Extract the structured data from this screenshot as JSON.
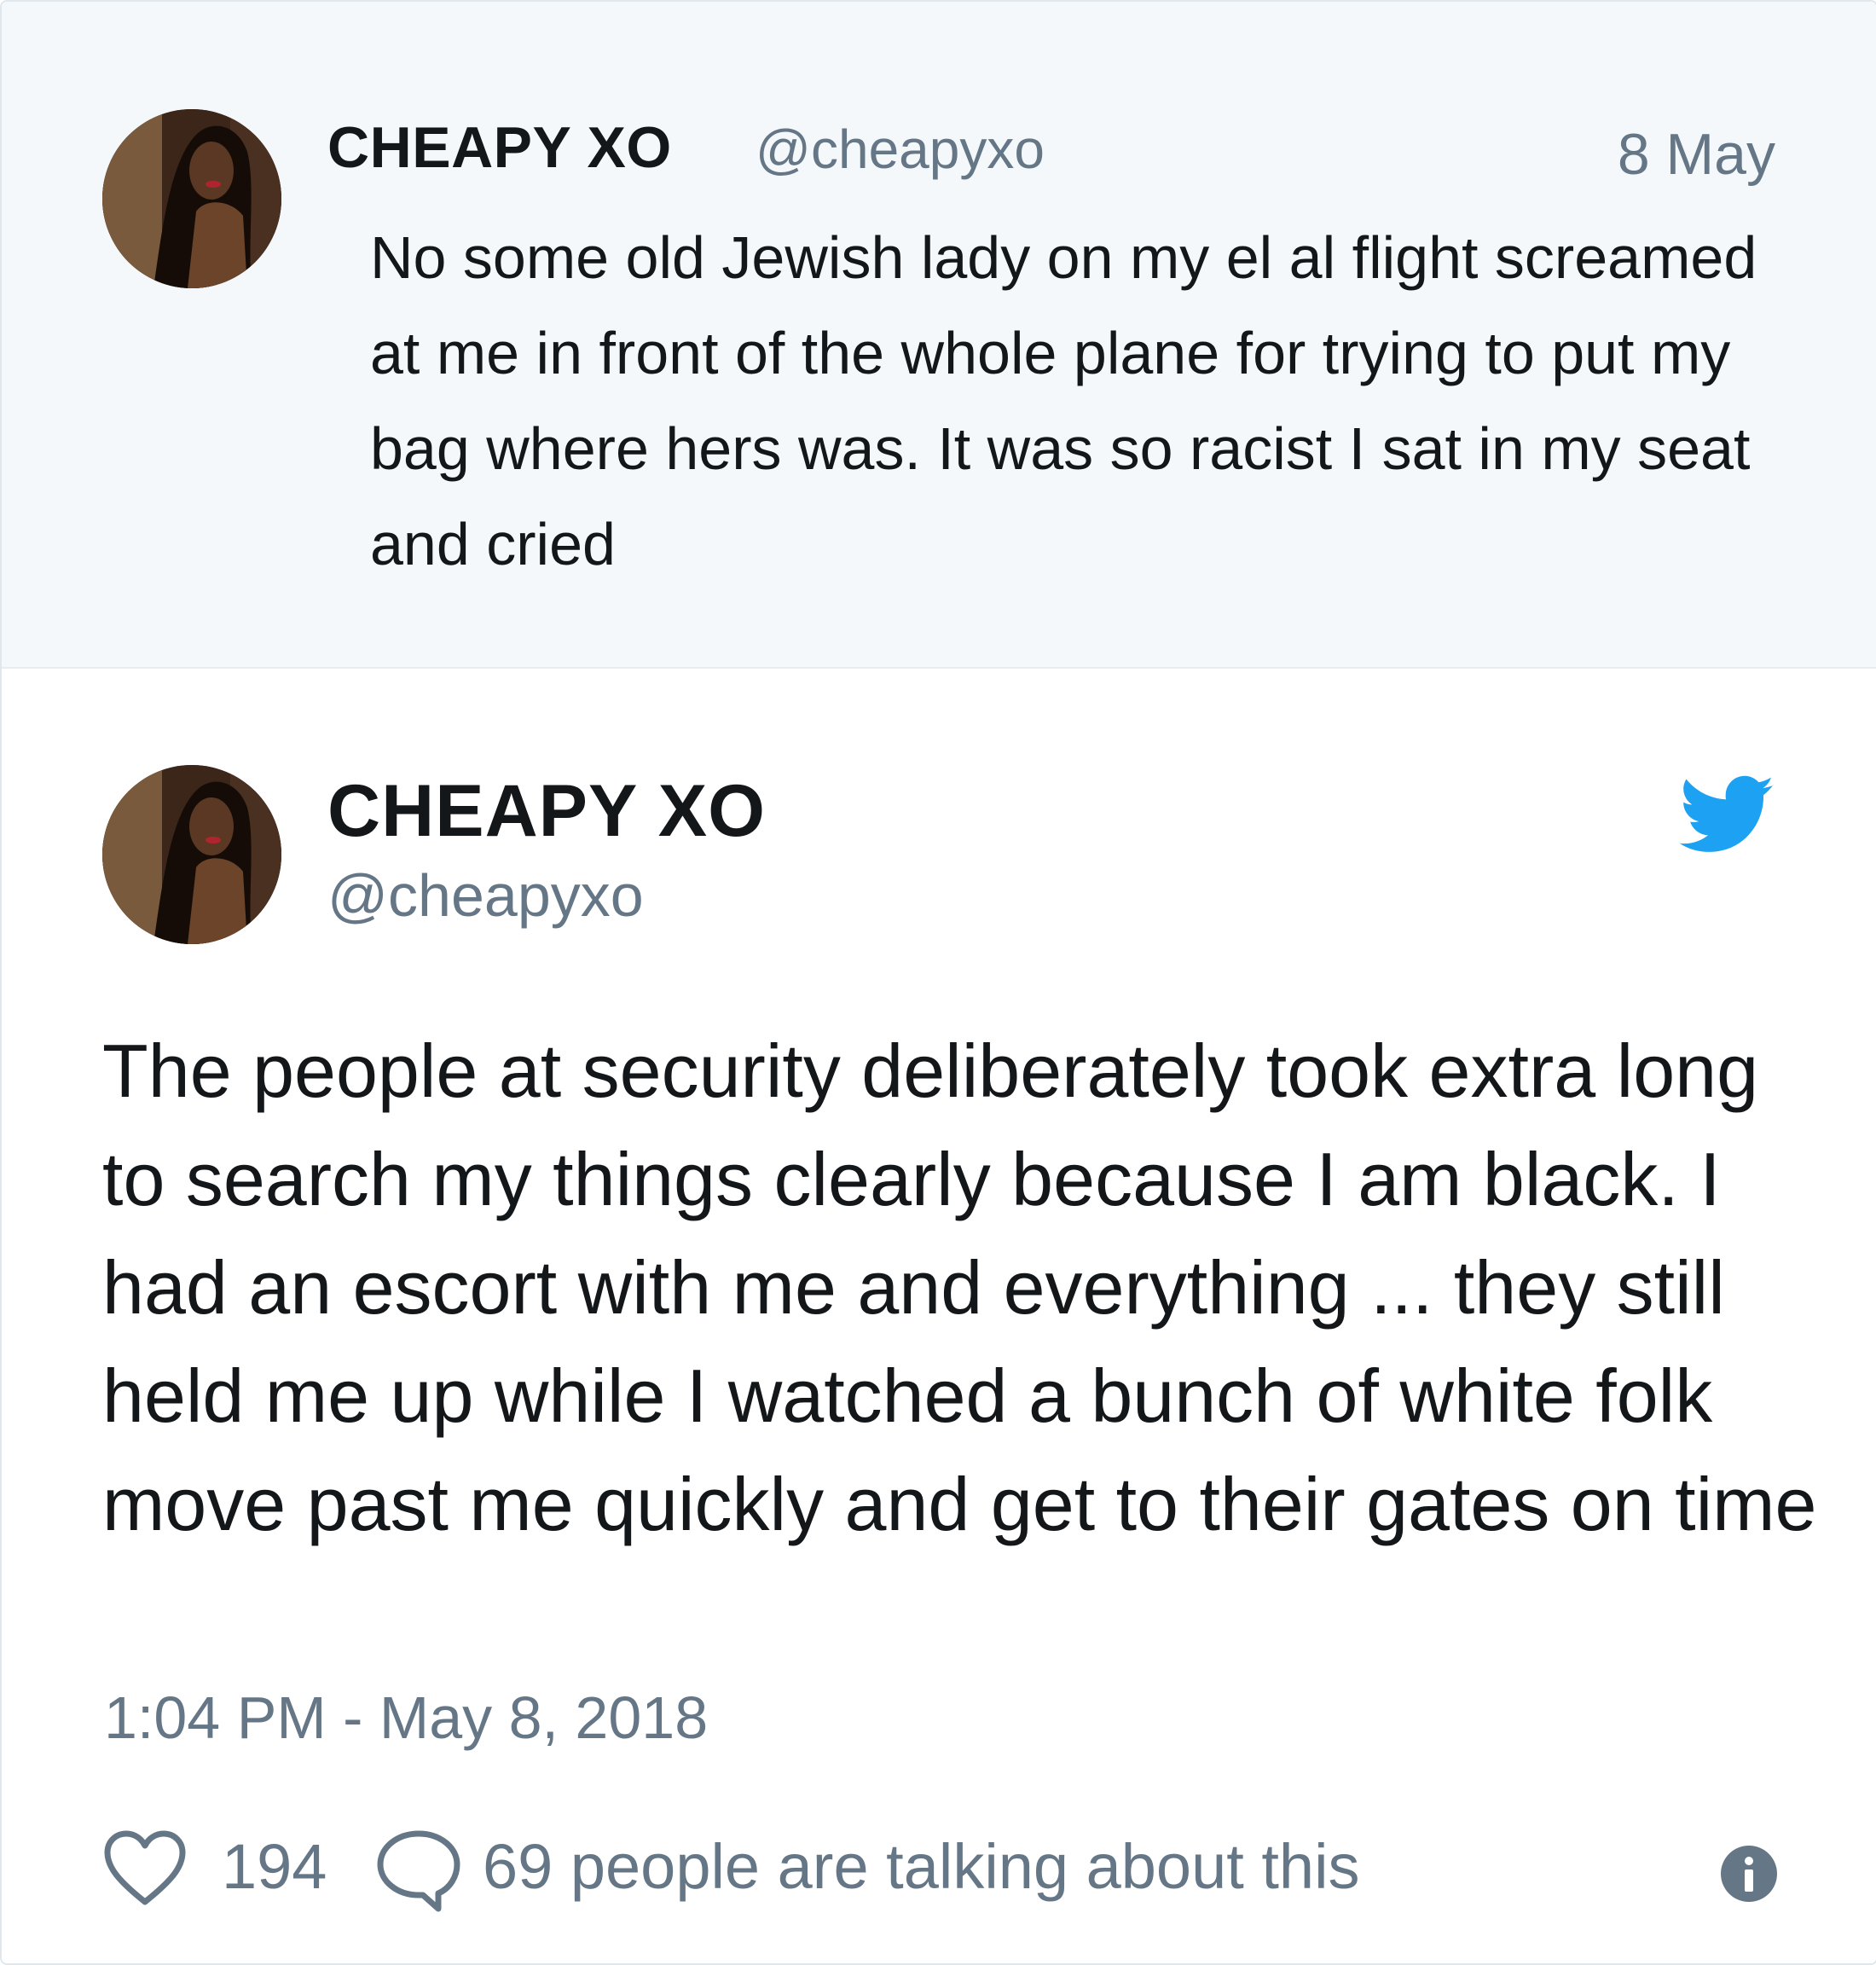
{
  "quoted_tweet": {
    "name": "CHEAPY XO",
    "handle": "@cheapyxo",
    "date": "8 May",
    "text": "No some old Jewish lady on my el al flight screamed at me in front of the whole plane for trying to put my bag where hers was. It was so racist I sat in my seat and cried"
  },
  "main_tweet": {
    "name": "CHEAPY XO",
    "handle": "@cheapyxo",
    "text": "The people at security deliberately took extra long to search my things clearly because I am black. I had an escort with me and everything ... they still held me up while I watched a bunch of white folk move past me quickly and get to their gates on time",
    "timestamp": "1:04 PM - May 8, 2018",
    "likes": "194",
    "talking": "69 people are talking about this"
  },
  "icons": {
    "brand": "twitter-bird-icon",
    "like": "heart-icon",
    "reply": "speech-bubble-icon",
    "info": "info-icon"
  },
  "colors": {
    "brand_blue": "#1da1f2",
    "text": "#14171a",
    "secondary": "#657786",
    "quoted_bg": "#f5f8fa"
  }
}
